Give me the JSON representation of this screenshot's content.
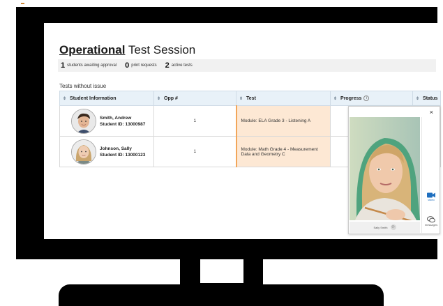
{
  "session": {
    "title_bold": "Operational",
    "title_rest": " Test Session"
  },
  "summary": {
    "awaiting_count": "1",
    "awaiting_label": "students awaiting approval",
    "print_count": "0",
    "print_label": "print requests",
    "active_count": "2",
    "active_label": "active tests"
  },
  "section_label": "Tests without issue",
  "table": {
    "headers": {
      "student": "Student Information",
      "opp": "Opp #",
      "test": "Test",
      "progress": "Progress",
      "status": "Status"
    },
    "rows": [
      {
        "name": "Smith, Andrew",
        "student_id": "Student ID: 13000987",
        "opp": "1",
        "test": "Module: ELA Grade 3 - Listening A"
      },
      {
        "name": "Johnson, Sally",
        "student_id": "Student ID: 13000123",
        "opp": "1",
        "test": "Module: Math Grade 4 - Measurement Data and Geometry C"
      }
    ]
  },
  "video_panel": {
    "close_label": "×",
    "caller_name": "Sally Smith",
    "video_label": "video",
    "messages_label": "messages"
  },
  "colors": {
    "header_bg": "#e8f1f8",
    "test_cell_bg": "#fde8d4",
    "test_cell_accent": "#f2a65a",
    "video_icon": "#1f6fbf",
    "monitor": "#000000"
  }
}
